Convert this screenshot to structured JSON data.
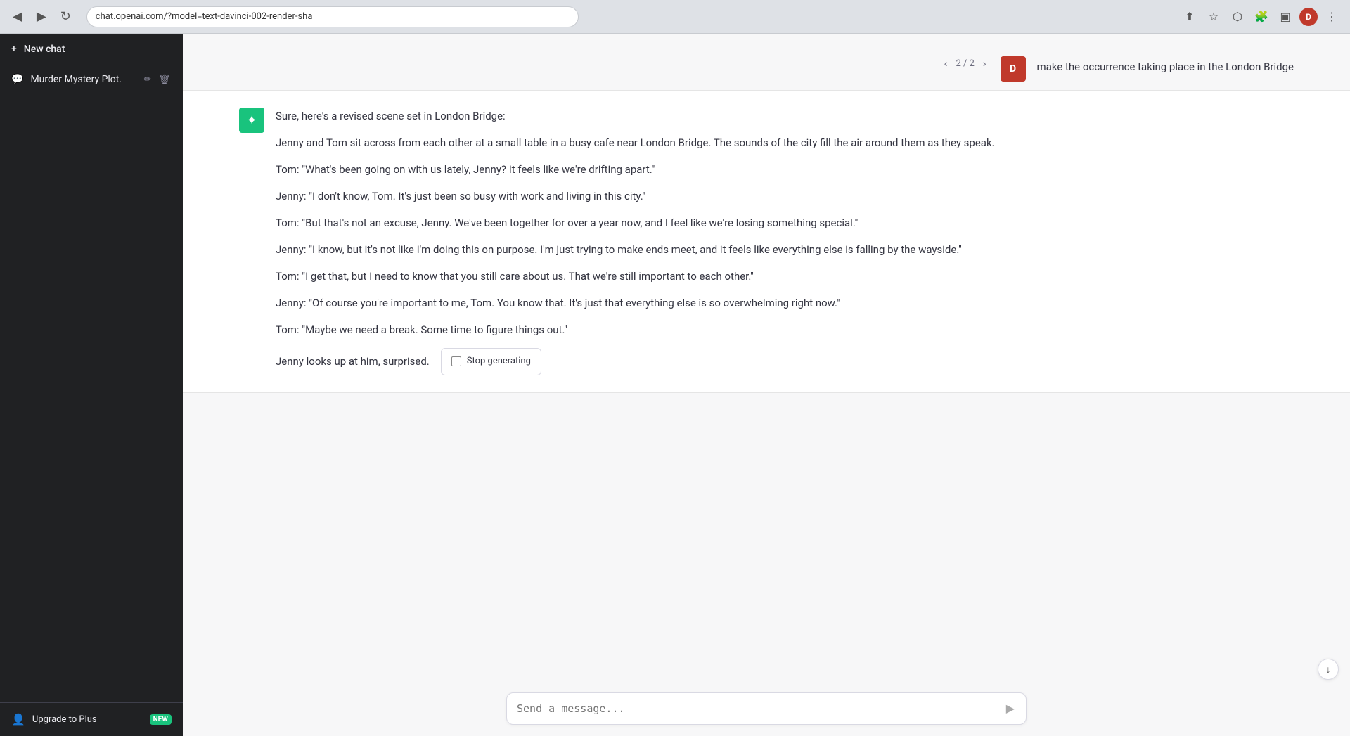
{
  "browser": {
    "url": "chat.openai.com/?model=text-davinci-002-render-sha",
    "back_btn": "◀",
    "forward_btn": "▶",
    "reload_btn": "↻",
    "share_icon": "⬆",
    "bookmark_icon": "☆",
    "extensions_icon": "⬡",
    "puzzle_icon": "🧩",
    "sidebar_icon": "▣",
    "user_initial": "D",
    "menu_icon": "⋮"
  },
  "sidebar": {
    "new_chat_label": "New chat",
    "chat_icon": "💬",
    "chat_title": "Murder Mystery Plot.",
    "edit_icon": "✏",
    "delete_icon": "🗑",
    "upgrade_label": "Upgrade to Plus",
    "upgrade_icon": "👤",
    "new_badge": "NEW"
  },
  "conversation": {
    "user_initial": "D",
    "nav": {
      "prev": "‹",
      "count": "2 / 2",
      "next": "›"
    },
    "user_message": "make the occurrence taking place in the London Bridge",
    "ai_intro": "Sure, here's a revised scene set in London Bridge:",
    "ai_paragraphs": [
      "Jenny and Tom sit across from each other at a small table in a busy cafe near London Bridge. The sounds of the city fill the air around them as they speak.",
      "Tom: \"What's been going on with us lately, Jenny? It feels like we're drifting apart.\"",
      "Jenny: \"I don't know, Tom. It's just been so busy with work and living in this city.\"",
      "Tom: \"But that's not an excuse, Jenny. We've been together for over a year now, and I feel like we're losing something special.\"",
      "Jenny: \"I know, but it's not like I'm doing this on purpose. I'm just trying to make ends meet, and it feels like everything else is falling by the wayside.\"",
      "Tom: \"I get that, but I need to know that you still care about us. That we're still important to each other.\"",
      "Jenny: \"Of course you're important to me, Tom. You know that. It's just that everything else is so overwhelming right now.\"",
      "Tom: \"Maybe we need a break. Some time to figure things out.\"",
      "Jenny looks up at him, surprised."
    ],
    "stop_btn_label": "Stop generating",
    "input_placeholder": "Send a message...",
    "send_icon": "▶",
    "scroll_down_icon": "↓"
  }
}
